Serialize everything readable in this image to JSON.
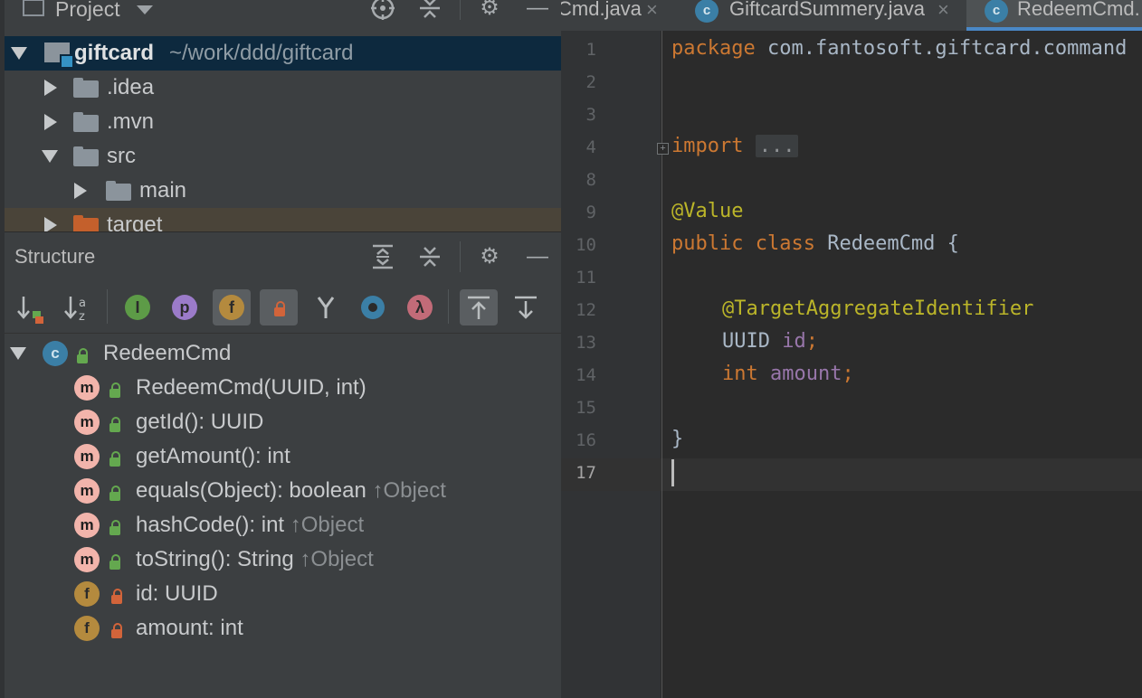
{
  "project_panel": {
    "title": "Project",
    "tree": [
      {
        "name": "giftcard",
        "path": "~/work/ddd/giftcard",
        "expanded": true,
        "selected": true
      },
      {
        "name": ".idea",
        "expanded": false
      },
      {
        "name": ".mvn",
        "expanded": false
      },
      {
        "name": "src",
        "expanded": true
      },
      {
        "name": "main",
        "expanded": false
      },
      {
        "name": "target",
        "expanded": false,
        "excluded": true
      }
    ]
  },
  "structure_panel": {
    "title": "Structure",
    "class_name": "RedeemCmd",
    "class_badge": "c",
    "items": [
      {
        "kind": "m",
        "label": "RedeemCmd(UUID, int)",
        "inherited": "",
        "access": "public"
      },
      {
        "kind": "m",
        "label": "getId(): UUID",
        "inherited": "",
        "access": "public"
      },
      {
        "kind": "m",
        "label": "getAmount(): int",
        "inherited": "",
        "access": "public"
      },
      {
        "kind": "m",
        "label": "equals(Object): boolean",
        "inherited": "↑Object",
        "access": "public"
      },
      {
        "kind": "m",
        "label": "hashCode(): int",
        "inherited": "↑Object",
        "access": "public"
      },
      {
        "kind": "m",
        "label": "toString(): String",
        "inherited": "↑Object",
        "access": "public"
      },
      {
        "kind": "f",
        "label": "id: UUID",
        "inherited": "",
        "access": "private"
      },
      {
        "kind": "f",
        "label": "amount: int",
        "inherited": "",
        "access": "private"
      }
    ],
    "toolbar_badges": {
      "interface": "I",
      "property": "p",
      "field": "f",
      "lambda": "λ"
    }
  },
  "editor": {
    "tabs": [
      {
        "label": "Cmd.java",
        "badge": "",
        "close": "×",
        "active": false
      },
      {
        "label": "GiftcardSummery.java",
        "badge": "c",
        "close": "×",
        "active": false
      },
      {
        "label": "RedeemCmd.",
        "badge": "c",
        "close": "",
        "active": true
      }
    ],
    "line_numbers": [
      "1",
      "2",
      "3",
      "4",
      "8",
      "9",
      "10",
      "11",
      "12",
      "13",
      "14",
      "15",
      "16",
      "17"
    ],
    "code": {
      "l1_kw": "package",
      "l1_rest": " com.fantosoft.giftcard.command",
      "l4_kw": "import",
      "l4_fold": "...",
      "l8_ann": "@Value",
      "l9_kw": "public class",
      "l9_rest": " RedeemCmd {",
      "l12_ann": "@TargetAggregateIdentifier",
      "l13_type": "UUID",
      "l13_field": "id",
      "l13_end": ";",
      "l14_kw": "int",
      "l14_field": "amount",
      "l14_end": ";",
      "l16": "}"
    }
  },
  "colors": {
    "keyword": "#cc7832",
    "annotation": "#bbb529",
    "field": "#9876aa",
    "selection": "#0d293e",
    "accent": "#4a88c7"
  },
  "icons": [
    "window-icon",
    "locate-icon",
    "collapse-all-icon",
    "gear-icon",
    "minimize-icon",
    "sort-visibility-icon",
    "sort-alpha-icon",
    "show-inherited-icon",
    "show-properties-icon",
    "show-fields-icon",
    "show-non-public-icon",
    "merge-icon",
    "circle-icon",
    "lambda-icon",
    "autoscroll-from-source-icon",
    "autoscroll-to-source-icon"
  ]
}
